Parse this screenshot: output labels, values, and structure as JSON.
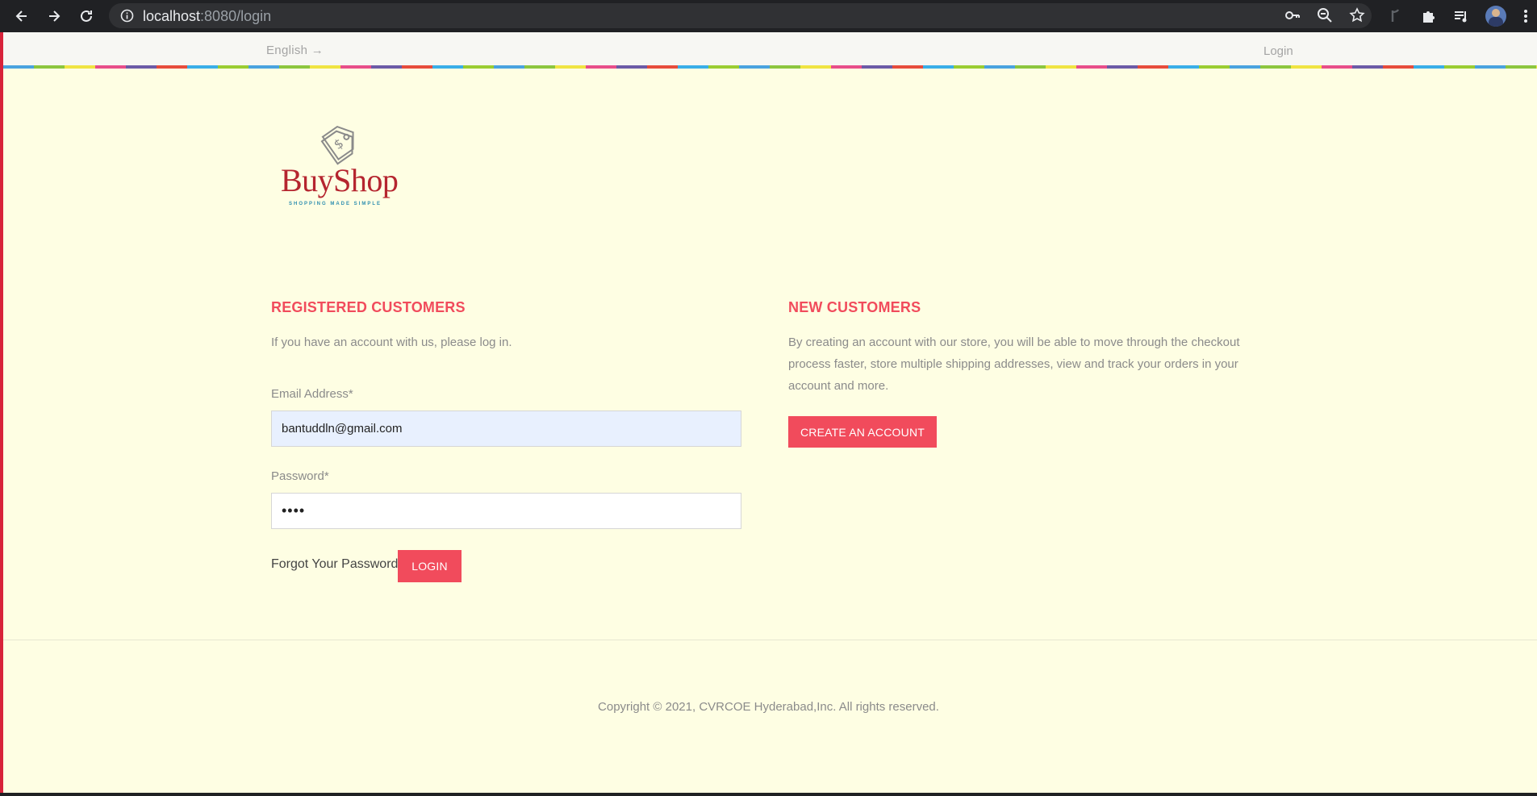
{
  "browser": {
    "url_host": "localhost",
    "url_path": ":8080/login",
    "icons": [
      "back-icon",
      "forward-icon",
      "reload-icon",
      "info-icon",
      "key-icon",
      "zoom-icon",
      "star-icon",
      "extension-icon",
      "puzzle-icon",
      "media-icon",
      "avatar",
      "menu-icon"
    ]
  },
  "topbar": {
    "language": "English →",
    "login": "Login"
  },
  "logo": {
    "name": "BuyShop",
    "tagline": "SHOPPING MADE SIMPLE"
  },
  "registered": {
    "title": "REGISTERED CUSTOMERS",
    "intro": "If you have an account with us, please log in.",
    "email_label": "Email Address*",
    "email_value": "bantuddln@gmail.com",
    "password_label": "Password*",
    "password_value": "••••",
    "forgot": "Forgot Your Password?",
    "login_button": "LOGIN"
  },
  "new_customers": {
    "title": "NEW CUSTOMERS",
    "line1": "By creating an account with our store, you will be able to move through the checkout",
    "line2": "process faster, store multiple shipping addresses, view and track your orders in your",
    "line3": "account and more.",
    "create_button": "CREATE AN ACCOUNT"
  },
  "footer": {
    "copyright": "Copyright © 2021, CVRCOE Hyderabad,Inc. All rights reserved."
  },
  "colors": {
    "accent": "#f14b5c",
    "page_bg": "#fefee3",
    "logo_red": "#b5252f"
  }
}
